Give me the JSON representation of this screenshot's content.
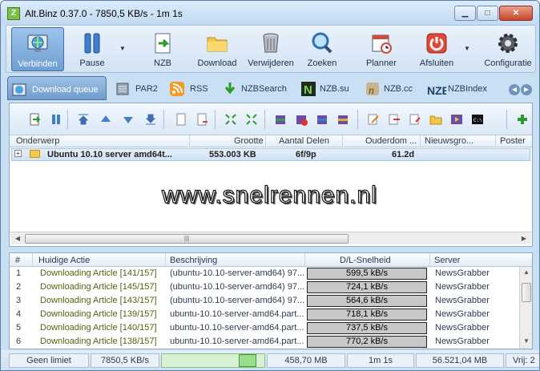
{
  "window": {
    "title": "Alt.Binz 0.37.0 - 7850,5 KB/s - 1m 1s",
    "controls": {
      "minimize": "▁",
      "maximize": "□",
      "close": "✕"
    },
    "icon_letter": "Z"
  },
  "ribbon": {
    "buttons": [
      {
        "id": "connect",
        "label": "Verbinden",
        "icon": "globe-icon"
      },
      {
        "id": "pause",
        "label": "Pause",
        "icon": "pause-icon"
      },
      {
        "id": "nzb",
        "label": "NZB",
        "icon": "nzb-add-icon"
      },
      {
        "id": "download",
        "label": "Download",
        "icon": "folder-icon"
      },
      {
        "id": "delete",
        "label": "Verwijderen",
        "icon": "trash-icon"
      },
      {
        "id": "search",
        "label": "Zoeken",
        "icon": "search-icon"
      },
      {
        "id": "planner",
        "label": "Planner",
        "icon": "calendar-icon"
      },
      {
        "id": "shutdown",
        "label": "Afsluiten",
        "icon": "power-icon"
      },
      {
        "id": "config",
        "label": "Configuratie",
        "icon": "gear-icon"
      }
    ],
    "dropdown_arrow": "▼"
  },
  "tabs": [
    {
      "label": "Download queue",
      "icon": "download-queue-icon"
    },
    {
      "label": "PAR2",
      "icon": "par2-icon"
    },
    {
      "label": "RSS",
      "icon": "rss-icon"
    },
    {
      "label": "NZBSearch",
      "icon": "nzbsearch-icon"
    },
    {
      "label": "NZB.su",
      "icon": "nzbsu-icon"
    },
    {
      "label": "NZB.cc",
      "icon": "nzbcc-icon"
    },
    {
      "label": "NZBIndex",
      "icon": "nzbindex-icon"
    }
  ],
  "tab_scroll": {
    "left": "◀",
    "right": "▶"
  },
  "queue": {
    "columns": [
      "Onderwerp",
      "Grootte",
      "Aantal Delen",
      "Ouderdom ...",
      "Nieuwsgro...",
      "Poster"
    ],
    "rows": [
      {
        "expand": "+",
        "subject": "Ubuntu 10.10 server amd64t...",
        "size": "553.003 KB",
        "parts": "6f/9p",
        "age": "61.2d"
      }
    ],
    "watermark": "www.snelrennen.nl"
  },
  "connections": {
    "columns": [
      "#",
      "Huidige Actie",
      "Beschrijving",
      "D/L-Snelheid",
      "Server"
    ],
    "rows": [
      {
        "n": "1",
        "action": "Downloading Article [141/157]",
        "desc": "(ubuntu-10.10-server-amd64) 97...",
        "speed": "599,5 kB/s",
        "server": "NewsGrabber"
      },
      {
        "n": "2",
        "action": "Downloading Article [145/157]",
        "desc": "(ubuntu-10.10-server-amd64) 97...",
        "speed": "724,1 kB/s",
        "server": "NewsGrabber"
      },
      {
        "n": "3",
        "action": "Downloading Article [143/157]",
        "desc": "(ubuntu-10.10-server-amd64) 97...",
        "speed": "564,6 kB/s",
        "server": "NewsGrabber"
      },
      {
        "n": "4",
        "action": "Downloading Article [139/157]",
        "desc": "ubuntu-10.10-server-amd64.part...",
        "speed": "718,1 kB/s",
        "server": "NewsGrabber"
      },
      {
        "n": "5",
        "action": "Downloading Article [140/157]",
        "desc": "ubuntu-10.10-server-amd64.part...",
        "speed": "737,5 kB/s",
        "server": "NewsGrabber"
      },
      {
        "n": "6",
        "action": "Downloading Article [138/157]",
        "desc": "ubuntu-10.10-server-amd64.part...",
        "speed": "770,2 kB/s",
        "server": "NewsGrabber"
      }
    ]
  },
  "status": {
    "limit": "Geen limiet",
    "speed": "7850,5 KB/s",
    "remaining_size": "458,70 MB",
    "time_left": "1m 1s",
    "free_space": "56.521,04 MB",
    "free": "Vrij: 2"
  },
  "colors": {
    "accent": "#6f9fd2",
    "speed_bar": "#c8c8c8",
    "graph": "#98dc8d"
  }
}
